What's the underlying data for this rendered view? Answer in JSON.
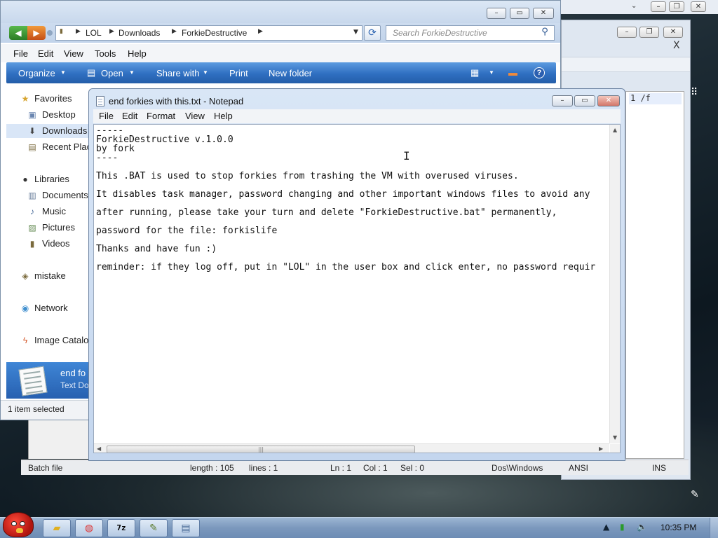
{
  "explorer": {
    "address": {
      "crumbs": [
        "LOL",
        "Downloads",
        "ForkieDestructive"
      ]
    },
    "search_placeholder": "Search ForkieDestructive",
    "menu": [
      "File",
      "Edit",
      "View",
      "Tools",
      "Help"
    ],
    "commands": {
      "organize": "Organize",
      "open": "Open",
      "share_with": "Share with",
      "print": "Print",
      "new_folder": "New folder"
    },
    "nav": {
      "favorites": "Favorites",
      "desktop": "Desktop",
      "downloads": "Downloads",
      "recent_places": "Recent Plac",
      "libraries": "Libraries",
      "documents": "Documents",
      "music": "Music",
      "pictures": "Pictures",
      "videos": "Videos",
      "mistake": "mistake",
      "network": "Network",
      "image_catalog": "Image Catalo"
    },
    "details": {
      "name": "end fo",
      "type": "Text Do"
    },
    "status": "1 item selected"
  },
  "notepad": {
    "title": "end forkies with this.txt - Notepad",
    "menu": [
      "File",
      "Edit",
      "Format",
      "View",
      "Help"
    ],
    "lines": [
      "-----",
      "ForkieDestructive v.1.0.0",
      "by fork",
      "----",
      "This .BAT is used to stop forkies from trashing the VM with overused viruses.",
      "It disables task manager, password changing and other important windows files to avoid any",
      "after running, please take your turn and delete \"ForkieDestructive.bat\" permanently,",
      "password for the file: forkislife",
      "Thanks and have fun :)",
      "reminder: if they log off, put in \"LOL\" in the user box and click enter, no password requir"
    ]
  },
  "batch_editor": {
    "line_text": "1 /f",
    "status": {
      "type": "Batch file",
      "length": "length : 105",
      "lines": "lines : 1",
      "ln": "Ln : 1",
      "col": "Col : 1",
      "sel": "Sel : 0",
      "eol": "Dos\\Windows",
      "encoding": "ANSI",
      "mode": "INS"
    }
  },
  "taskbar": {
    "clock": "10:35 PM"
  },
  "colors": {
    "command_bar": "#2f6fc1",
    "selection": "#d9e6f7"
  }
}
